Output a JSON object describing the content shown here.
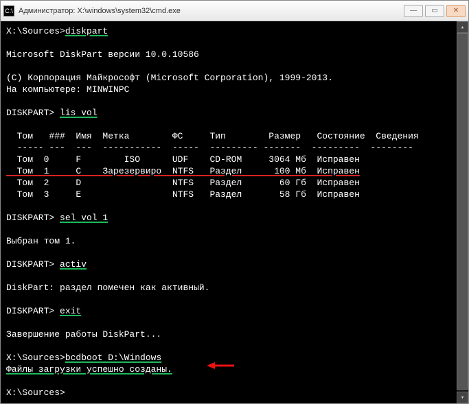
{
  "titlebar": {
    "icon_text": "C:\\",
    "title": "Администратор: X:\\windows\\system32\\cmd.exe",
    "min": "—",
    "max": "▭",
    "close": "✕"
  },
  "scroll": {
    "up": "▴",
    "down": "▾"
  },
  "lines": {
    "l1a": "X:\\Sources>",
    "l1b": "diskpart",
    "l2": "Microsoft DiskPart версии 10.0.10586",
    "l3": "(C) Корпорация Майкрософт (Microsoft Corporation), 1999-2013.",
    "l4": "На компьютере: MINWINPC",
    "l5a": "DISKPART> ",
    "l5b": "lis vol",
    "hdr": "  Том   ###  Имя  Метка        ФС     Тип        Размер   Состояние  Сведения",
    "hdrSep": "  ----- ---  ---  -----------  -----  --------- -------  ---------  --------",
    "r0": "  Том  0     F        ISO      UDF    CD-ROM     3064 Мб  Исправен",
    "r1": "  Том  1     C    Зарезервиро  NTFS   Раздел      100 Мб  Исправен",
    "r2": "  Том  2     D                 NTFS   Раздел       60 Гб  Исправен",
    "r3": "  Том  3     E                 NTFS   Раздел       58 Гб  Исправен",
    "l6a": "DISKPART> ",
    "l6b": "sel vol 1",
    "l7": "Выбран том 1.",
    "l8a": "DISKPART> ",
    "l8b": "activ",
    "l9": "DiskPart: раздел помечен как активный.",
    "l10a": "DISKPART> ",
    "l10b": "exit",
    "l11": "Завершение работы DiskPart...",
    "l12a": "X:\\Sources>",
    "l12b": "bcdboot D:\\Windows",
    "l13": "Файлы загрузки успешно созданы.",
    "l14": "X:\\Sources>"
  }
}
